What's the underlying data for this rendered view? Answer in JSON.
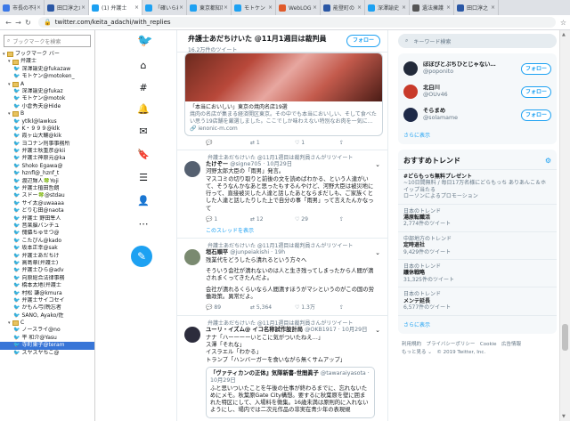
{
  "browser": {
    "tabs": [
      {
        "label": "市長の不祥",
        "fav": "#3b78e7"
      },
      {
        "label": "田口淳之介",
        "fav": "#2a57a5"
      },
      {
        "label": "(1) 弁護士",
        "fav": "#1da1f2",
        "active": true
      },
      {
        "label": "「確いられ",
        "fav": "#1da1f2"
      },
      {
        "label": "東京都知事",
        "fav": "#1da1f2"
      },
      {
        "label": "モトケン (",
        "fav": "#1da1f2"
      },
      {
        "label": "WebLOGビ",
        "fav": "#e05a2a"
      },
      {
        "label": "能登町の",
        "fav": "#2a57a5"
      },
      {
        "label": "深澤諭史",
        "fav": "#1da1f2"
      },
      {
        "label": "遺法擁護",
        "fav": "#555555"
      },
      {
        "label": "田口淳之",
        "fav": "#2a57a5"
      }
    ],
    "url": "twitter.com/keita_adachi/with_replies"
  },
  "sidebar": {
    "search_placeholder": "ブックマークを検索",
    "items": [
      {
        "label": "ブックマーク バー",
        "type": "folder",
        "indent": 0
      },
      {
        "label": "弁護士",
        "type": "folder",
        "indent": 1
      },
      {
        "label": "深澤諭史@fukazaw",
        "type": "tw",
        "indent": 2
      },
      {
        "label": "モトケン@motoken_",
        "type": "tw",
        "indent": 2
      },
      {
        "label": "A",
        "type": "folder",
        "indent": 1
      },
      {
        "label": "深澤諭史@fukaz",
        "type": "tw",
        "indent": 2
      },
      {
        "label": "モトケン@motok",
        "type": "tw",
        "indent": 2
      },
      {
        "label": "小倉秀夫@Hide",
        "type": "tw",
        "indent": 2
      },
      {
        "label": "B",
        "type": "folder",
        "indent": 1
      },
      {
        "label": "ytlkl@lawkus",
        "type": "tw",
        "indent": 2
      },
      {
        "label": "K・９９９@klk",
        "type": "tw",
        "indent": 2
      },
      {
        "label": "霞ヶ山大輔@kik",
        "type": "tw",
        "indent": 2
      },
      {
        "label": "ヨコナン刑事事務所",
        "type": "tw",
        "indent": 2
      },
      {
        "label": "弁護士秋重彦@kii",
        "type": "tw",
        "indent": 2
      },
      {
        "label": "弁護士神原元@ka",
        "type": "tw",
        "indent": 2
      },
      {
        "label": "Shoko Egawa@",
        "type": "tw",
        "indent": 2
      },
      {
        "label": "hznfl@_hznf_t",
        "type": "tw",
        "indent": 2
      },
      {
        "label": "渡辺輝人🍀Yoji",
        "type": "tw",
        "indent": 2
      },
      {
        "label": "弁護士植田哲朗",
        "type": "tw",
        "indent": 2
      },
      {
        "label": "スドー🍀@stdau",
        "type": "tw",
        "indent": 2
      },
      {
        "label": "サイ太@uwaaaa",
        "type": "tw",
        "indent": 2
      },
      {
        "label": "どりむ田@naota",
        "type": "tw",
        "indent": 2
      },
      {
        "label": "弁護士 野田隼人",
        "type": "tw",
        "indent": 2
      },
      {
        "label": "音楽脳バンチュ",
        "type": "tw",
        "indent": 2
      },
      {
        "label": "傀儡ちゅせつ@",
        "type": "tw",
        "indent": 2
      },
      {
        "label": "こたぴん@kado",
        "type": "tw",
        "indent": 2
      },
      {
        "label": "坂本正幸@sak",
        "type": "tw",
        "indent": 2
      },
      {
        "label": "弁護士あだちけ",
        "type": "tw",
        "indent": 2
      },
      {
        "label": "高島章(弁護士)",
        "type": "tw",
        "indent": 2
      },
      {
        "label": "弁護士ひら@adv",
        "type": "tw",
        "indent": 2
      },
      {
        "label": "向原総合法律事務",
        "type": "tw",
        "indent": 2
      },
      {
        "label": "橋本太地(弁護士",
        "type": "tw",
        "indent": 2
      },
      {
        "label": "村松 謙@kmura",
        "type": "tw",
        "indent": 2
      },
      {
        "label": "弁護士サイコセイ",
        "type": "tw",
        "indent": 2
      },
      {
        "label": "かもん弓(晩忘者",
        "type": "tw",
        "indent": 2
      },
      {
        "label": "SANO, Ayako/佐",
        "type": "tw",
        "indent": 2
      },
      {
        "label": "C",
        "type": "folder",
        "indent": 1
      },
      {
        "label": "ノースライ@no",
        "type": "tw",
        "indent": 2
      },
      {
        "label": "平 和介@Yasu",
        "type": "tw",
        "indent": 2
      },
      {
        "label": "寺町東子@teram",
        "type": "tw",
        "indent": 2,
        "selected": true
      },
      {
        "label": "スヤスヤちこ@",
        "type": "tw",
        "indent": 2
      }
    ]
  },
  "main": {
    "header_name": "弁護士あだちけいた @11月1週目は裁判員",
    "header_count": "16.2万件のツイート",
    "follow_label": "フォロー",
    "card": {
      "title": "「本当においしい」東京の焼肉名店19選",
      "desc": "焼肉の名店が集まる経済開区東京。その中でも本当においしい、そして食べたい思う19店舗を厳選しました。ここでしか味わえない特別なお肉を一気に…",
      "domain": "🔗 ienonic-m.com"
    },
    "card_actions": [
      "💬",
      "⇄ 1",
      "♡ 1",
      "⇪"
    ],
    "tweets": [
      {
        "rt": "弁護士あだちけいた @11月1週目は裁判員さんがリツイート",
        "name": "たけぞー",
        "handle": "@signe705 · 10月29日",
        "lines": [
          "河野太郎大臣の「雨男」発言。",
          "マスコミの切り取りと前後の文を読めばわかる、という人達がいて、そうなんかなあと思ったもするんやけど、河野大臣は被災地に行って、直接被災した人達と話したあとならまだしも、ご家族くとした人達と話したりした上で自分の事「雨男」って言えたんかなって"
        ],
        "actions": [
          "💬 1",
          "⇄ 12",
          "♡ 29",
          "⇪"
        ],
        "more": "このスレッドを表示",
        "av": "#556070"
      },
      {
        "rt": "弁護士あだちけいた @11月1週目は裁判員さんがリツイート",
        "name": "垣石順平",
        "handle": "@junpeiakishi · 19h",
        "lines": [
          "残業代をどうしたら潰れるという方々へ",
          "",
          "そういう会社が潰れないのは人と生き残ってしまったから人間が潰されまくってきたんだよ。",
          "",
          "会社が潰れるくらいなら人間潰すほうがマシというのがこの国の労働政策。異常だよ。"
        ],
        "actions": [
          "💬 89",
          "⇄ 5,364",
          "♡ 1.3万",
          "⇪"
        ],
        "more": "",
        "av": "#7a8a70"
      },
      {
        "rt": "弁護士あだちけいた @11月1週目は裁判員さんがリツイート",
        "name": "ユーリ・イズム@ イコ名称試作設計局",
        "handle": "@OKB1917 · 10月29日",
        "lines": [
          "ナナ「ハーーーーいとこに気がついたねえ…」",
          "ス澤「それな」",
          "イスラエル「わかる」",
          "トランプ「ハンバーガーを食いながら無くサムアップ」"
        ],
        "actions": [],
        "more": "",
        "av": "#2c2c3c",
        "quote": {
          "name": "「ヴァティカンの正体』気隊新書-世間眞子",
          "handle": "@tawaraiyasota · 10月29日",
          "lines": [
            "ふと思いついたことを午後の仕事が終わるまでに、忘れないためにメモ。秋葉原Gate City構想。要するに秋葉原を壁に囲まれた特区にして、入場料を徴集。16歳未満は原則的に入れないようにし、場内では二次元作品の非実在青少年の表現規"
          ]
        }
      }
    ]
  },
  "right": {
    "search_placeholder": "キーワード検索",
    "accounts": [
      {
        "name": "ぽぽぴとぷちひとじゃない…",
        "handle": "@poponito",
        "av": "#222a3a"
      },
      {
        "name": "北白川",
        "handle": "@OUv46",
        "av": "#c83a2a"
      },
      {
        "name": "そらまめ",
        "handle": "@solamame",
        "av": "#1e2a48"
      }
    ],
    "follow_label": "フォロー",
    "show_more": "さらに表示",
    "trends_title": "おすすめトレンド",
    "trends": [
      {
        "ctx": "",
        "name": "#どらもっち無料プレゼント",
        "desc": "~10日間無料 / 毎日17万名様にどらもっち ありあんこ＆ホイップ当たる",
        "promo": "ローソンによるプロモーション"
      },
      {
        "ctx": "日本のトレンド",
        "name": "湯原転職活",
        "desc": "2,774件のツイート",
        "promo": ""
      },
      {
        "ctx": "中部地方のトレンド",
        "name": "定時退社",
        "desc": "9,429件のツイート",
        "promo": ""
      },
      {
        "ctx": "日本のトレンド",
        "name": "議休戦略",
        "desc": "31,325件のツイート",
        "promo": ""
      },
      {
        "ctx": "日本のトレンド",
        "name": "メンテ延長",
        "desc": "6,577件のツイート",
        "promo": ""
      }
    ],
    "trends_more": "さらに表示",
    "footer_line1": "利用規約　プライバシーポリシー　Cookie　広告情報",
    "footer_line2": "もっと見る ⌄　© 2019 Twitter, Inc."
  },
  "icons": {
    "twitter_bird": "twitter-bird-icon",
    "home": "home-icon",
    "explore": "hashtag-icon",
    "notifications": "bell-icon",
    "messages": "mail-icon",
    "bookmarks": "bookmark-icon",
    "lists": "list-icon",
    "profile": "profile-icon",
    "more": "more-icon",
    "compose": "compose-icon"
  },
  "colors": {
    "accent": "#1da1f2"
  }
}
